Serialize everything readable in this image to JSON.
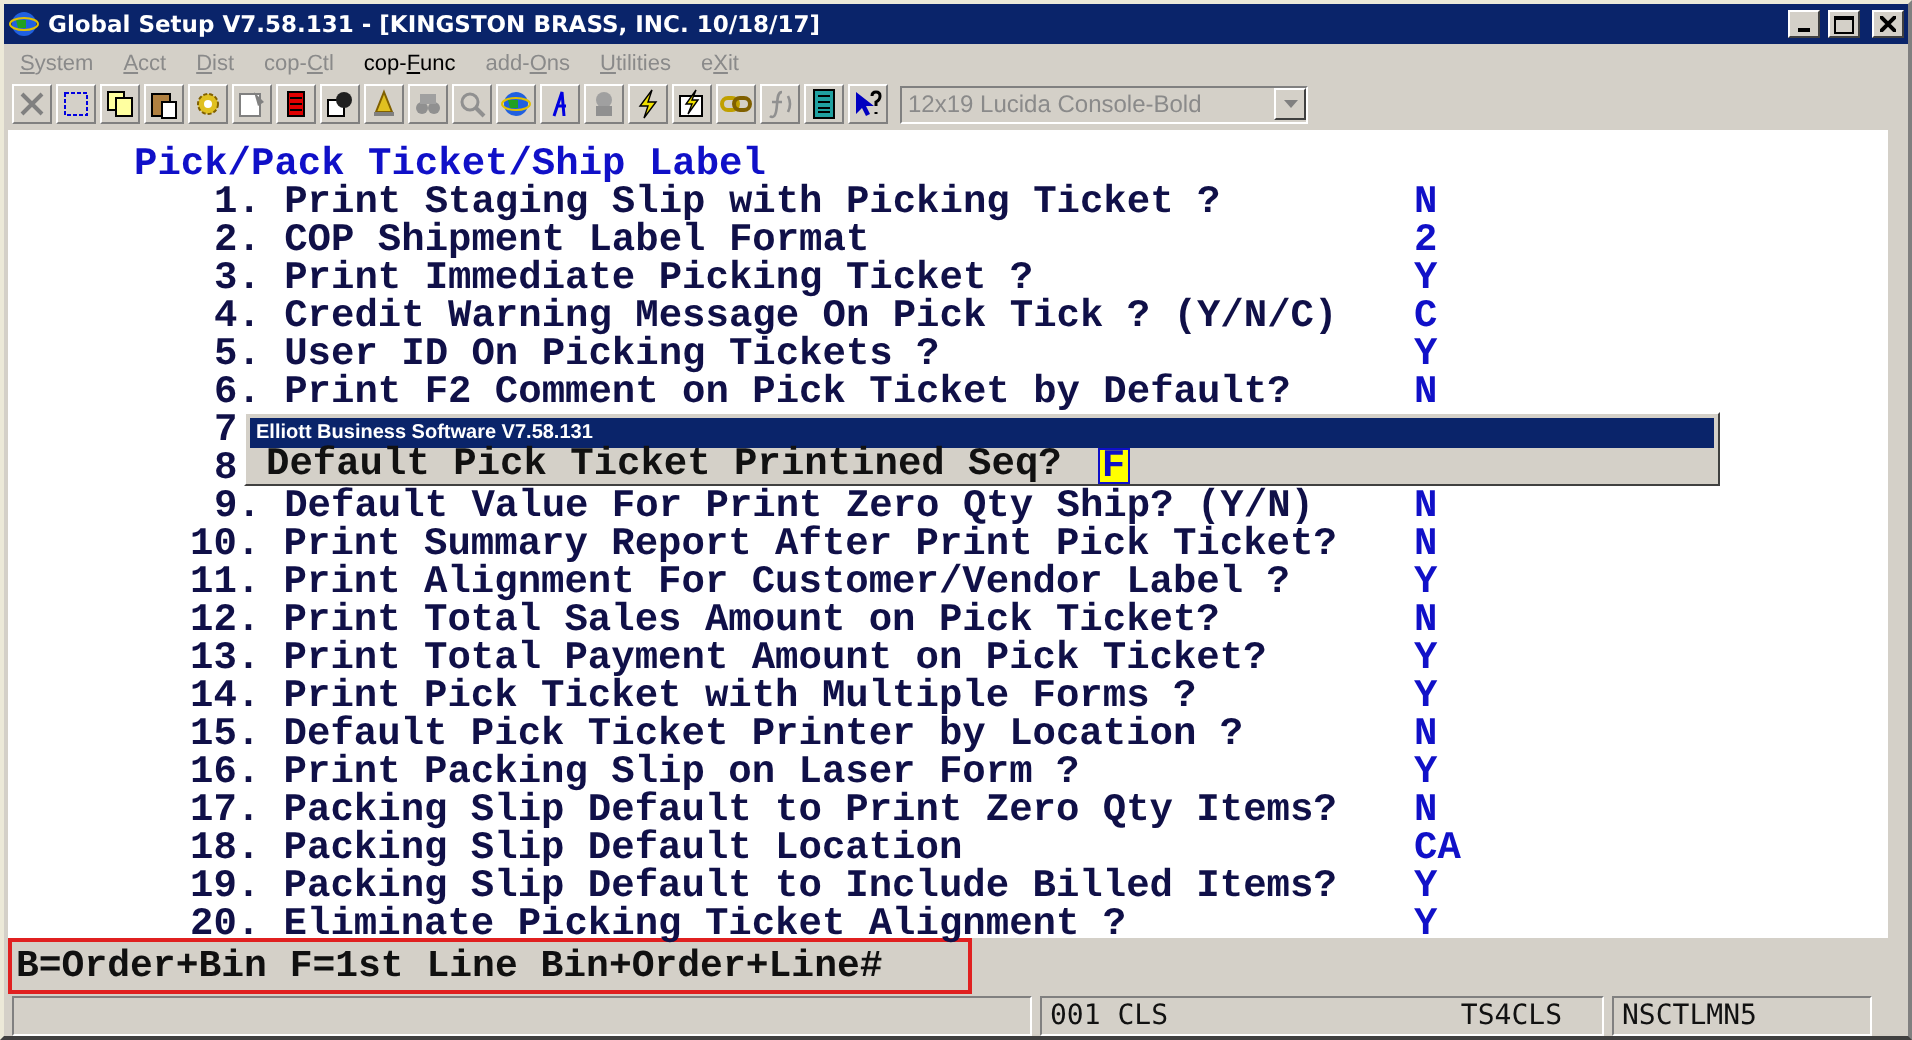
{
  "window": {
    "title": "Global Setup V7.58.131 - [KINGSTON BRASS, INC. 10/18/17]"
  },
  "menu": [
    {
      "key": "S",
      "after": "ystem",
      "disabled": true
    },
    {
      "key": "A",
      "after": "cct",
      "disabled": true
    },
    {
      "key": "D",
      "after": "ist",
      "disabled": true
    },
    {
      "before": "cop-",
      "key": "C",
      "after": "tl",
      "disabled": true
    },
    {
      "before": "cop-",
      "key": "F",
      "after": "unc",
      "disabled": false
    },
    {
      "before": "add-",
      "key": "O",
      "after": "ns",
      "disabled": true
    },
    {
      "key": "U",
      "after": "tilities",
      "disabled": true
    },
    {
      "before": "e",
      "key": "X",
      "after": "it",
      "disabled": true
    }
  ],
  "font_selector": {
    "value": "12x19 Lucida Console-Bold",
    "disabled": true
  },
  "screen": {
    "heading": "Pick/Pack Ticket/Ship Label",
    "rows": [
      {
        "label": "1. Print Staging Slip with Picking Ticket ?",
        "value": "N"
      },
      {
        "label": "2. COP Shipment Label Format",
        "value": "2"
      },
      {
        "label": "3. Print Immediate Picking Ticket ?",
        "value": "Y"
      },
      {
        "label": "4. Credit Warning Message On Pick Tick ? (Y/N/C)",
        "value": "C"
      },
      {
        "label": "5. User ID On Picking Tickets ?",
        "value": "Y"
      },
      {
        "label": "6. Print F2 Comment on Pick Ticket by Default?",
        "value": "N"
      },
      {
        "label": "7"
      },
      {
        "label": "8"
      },
      {
        "label": "9. Default Value For Print Zero Qty Ship? (Y/N)",
        "value": "N"
      },
      {
        "label": "10. Print Summary Report After Print Pick Ticket?",
        "value": "N"
      },
      {
        "label": "11. Print Alignment For Customer/Vendor Label ?",
        "value": "Y"
      },
      {
        "label": "12. Print Total Sales Amount on Pick Ticket?",
        "value": "N"
      },
      {
        "label": "13. Print Total Payment Amount on Pick Ticket?",
        "value": "Y"
      },
      {
        "label": "14. Print Pick Ticket with Multiple Forms ?",
        "value": "Y"
      },
      {
        "label": "15. Default Pick Ticket Printer by Location ?",
        "value": "N"
      },
      {
        "label": "16. Print Packing Slip on Laser Form ?",
        "value": "Y"
      },
      {
        "label": "17. Packing Slip Default to Print Zero Qty Items?",
        "value": "N"
      },
      {
        "label": "18. Packing Slip Default Location",
        "value": "CA"
      },
      {
        "label": "19. Packing Slip Default to Include Billed Items?",
        "value": "Y"
      },
      {
        "label": "20. Eliminate Picking Ticket Alignment ?",
        "value": "Y"
      }
    ]
  },
  "dialog": {
    "title": "Elliott Business Software V7.58.131",
    "prompt": "Default Pick Ticket Printined Seq?",
    "value": "F"
  },
  "message": {
    "text": "B=Order+Bin F=1st Line Bin+Order+Line#",
    "highlighted": true
  },
  "status_bar": [
    "001 CLS",
    "TS4CLS",
    "NSCTLMN5"
  ]
}
